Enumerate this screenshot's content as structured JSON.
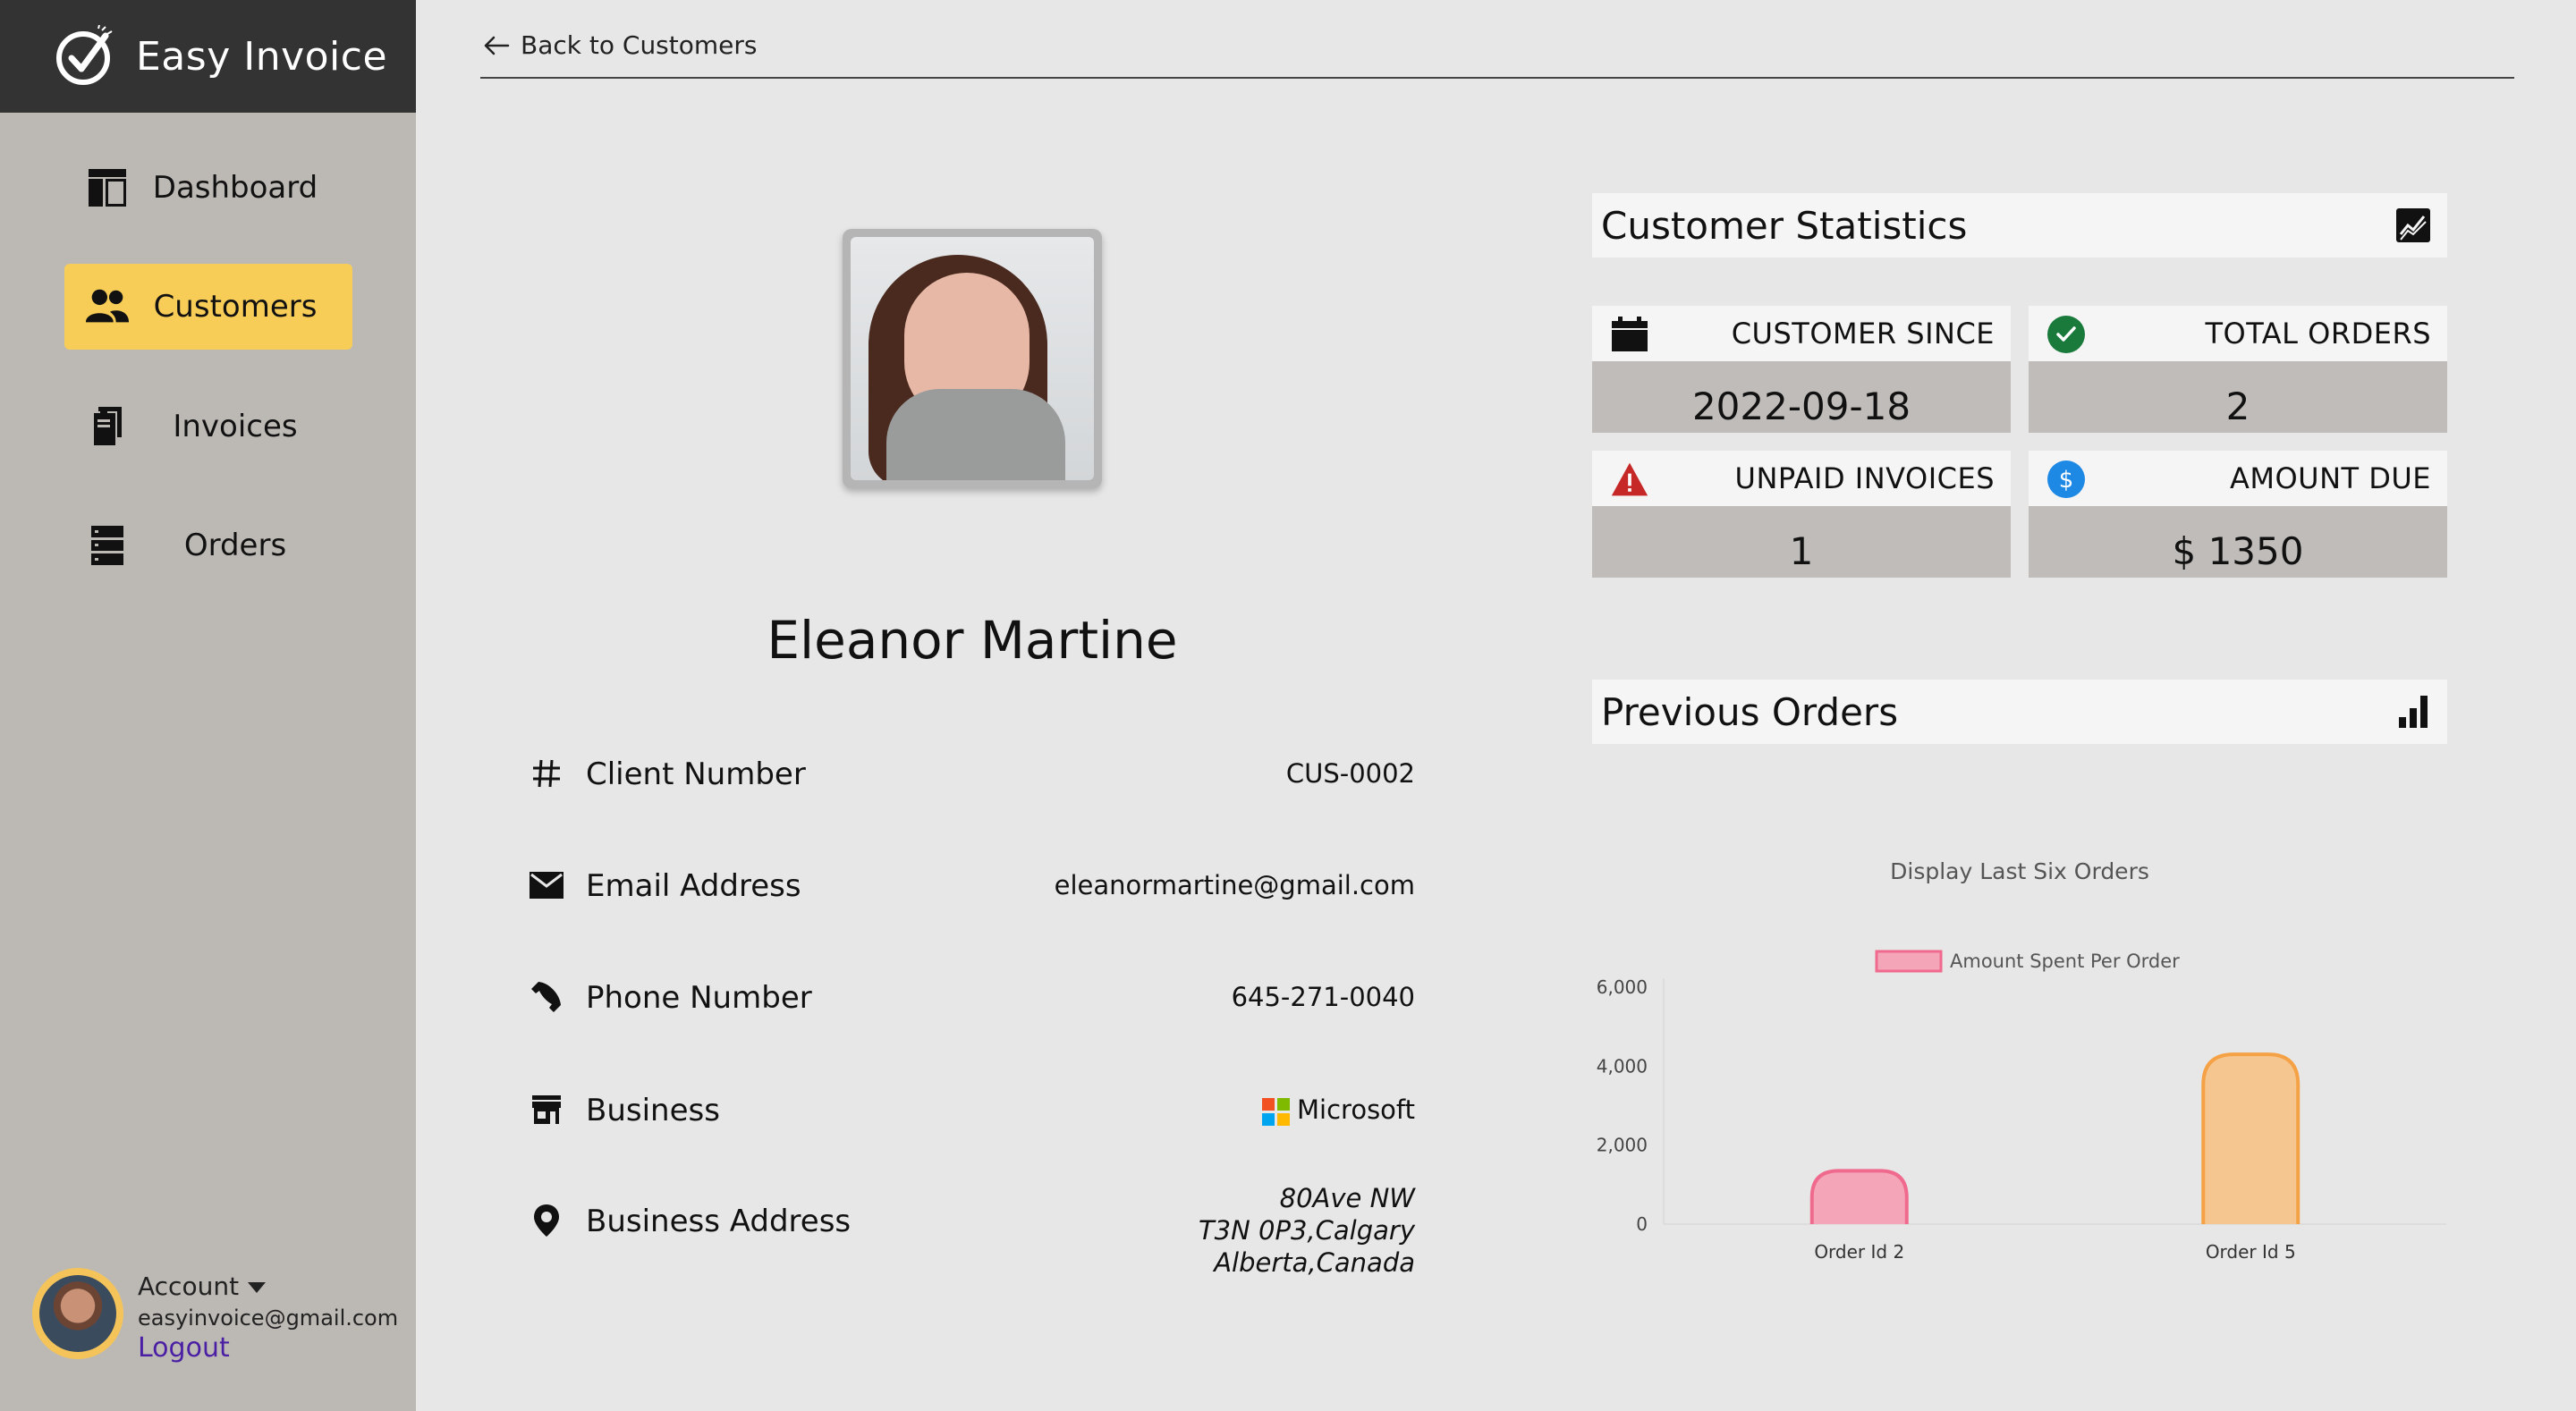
{
  "app": {
    "name": "Easy Invoice"
  },
  "sidebar": {
    "items": [
      {
        "label": "Dashboard",
        "icon": "dashboard-icon",
        "active": false
      },
      {
        "label": "Customers",
        "icon": "customers-icon",
        "active": true
      },
      {
        "label": "Invoices",
        "icon": "invoices-icon",
        "active": false
      },
      {
        "label": "Orders",
        "icon": "orders-icon",
        "active": false
      }
    ],
    "account": {
      "label": "Account",
      "email": "easyinvoice@gmail.com",
      "logout": "Logout"
    }
  },
  "header": {
    "back_label": "Back to Customers"
  },
  "customer": {
    "name": "Eleanor Martine",
    "details": {
      "client_number_label": "Client Number",
      "client_number": "CUS-0002",
      "email_label": "Email Address",
      "email": "eleanormartine@gmail.com",
      "phone_label": "Phone Number",
      "phone": "645-271-0040",
      "business_label": "Business",
      "business": "Microsoft",
      "address_label": "Business Address",
      "address_line1": "80Ave NW",
      "address_line2": "T3N 0P3,Calgary",
      "address_line3": "Alberta,Canada"
    }
  },
  "stats": {
    "title": "Customer Statistics",
    "customer_since_label": "CUSTOMER SINCE",
    "customer_since": "2022-09-18",
    "total_orders_label": "TOTAL ORDERS",
    "total_orders": "2",
    "unpaid_invoices_label": "UNPAID INVOICES",
    "unpaid_invoices": "1",
    "amount_due_label": "AMOUNT DUE",
    "amount_due": "$ 1350"
  },
  "orders": {
    "title": "Previous Orders",
    "chart_title": "Display Last Six Orders"
  },
  "colors": {
    "accent": "#f7cd57",
    "sidebar": "#bcb9b5",
    "brand_bar": "#333333",
    "logout": "#4b1fa3",
    "bar1_fill": "#f4a6b8",
    "bar1_stroke": "#f06a8e",
    "bar2_fill": "#f6c690",
    "bar2_stroke": "#f4a245"
  },
  "chart_data": {
    "type": "bar",
    "title": "Display Last Six Orders",
    "categories": [
      "Order Id 2",
      "Order Id 5"
    ],
    "series": [
      {
        "name": "Amount Spent Per Order",
        "values": [
          1350,
          4300
        ]
      }
    ],
    "ylim": [
      0,
      6000
    ],
    "yticks": [
      0,
      2000,
      4000,
      6000
    ],
    "ytick_labels": [
      "0",
      "2,000",
      "4,000",
      "6,000"
    ],
    "legend": "top",
    "grid": false
  }
}
